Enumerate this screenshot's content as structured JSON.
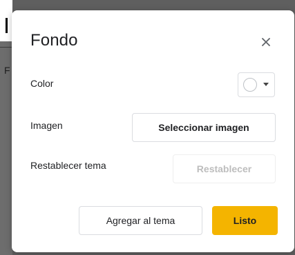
{
  "dialog": {
    "title": "Fondo",
    "close_icon": "close-icon",
    "labels": {
      "color": "Color",
      "image": "Imagen",
      "reset_theme": "Restablecer tema"
    },
    "color_picker": {
      "selected_color": "#ffffff",
      "icon": "chevron-down-icon"
    },
    "buttons": {
      "select_image": "Seleccionar imagen",
      "reset": "Restablecer",
      "add_to_theme": "Agregar al tema",
      "done": "Listo"
    },
    "colors": {
      "primary_accent": "#f4b400",
      "disabled_text": "#bdbdbd"
    }
  },
  "background": {
    "visible_letter": "F"
  }
}
